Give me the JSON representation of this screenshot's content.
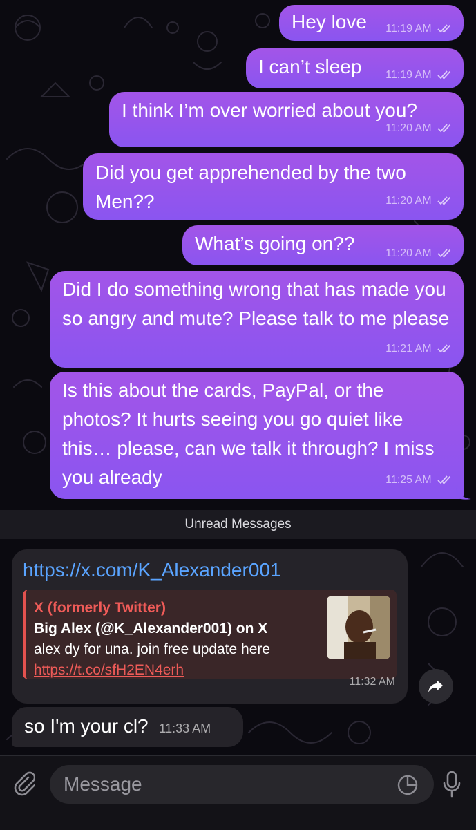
{
  "outgoing": [
    {
      "text": "Hey love",
      "time": "11:19 AM"
    },
    {
      "text": "I can’t sleep",
      "time": "11:19 AM"
    },
    {
      "text": "I think I’m over worried about you?",
      "time": "11:20 AM"
    },
    {
      "text": "Did you get apprehended by the two Men??",
      "time": "11:20 AM"
    },
    {
      "text": "What’s going on??",
      "time": "11:20 AM"
    },
    {
      "text": "Did I do something wrong that has made you so angry and mute? Please talk to me please",
      "time": "11:21 AM"
    },
    {
      "text": "Is this about the cards, PayPal, or the photos?  It hurts seeing you go quiet like this… please, can we talk it through? I miss you already",
      "time": "11:25 AM"
    }
  ],
  "divider": {
    "label": "Unread Messages"
  },
  "incoming": {
    "link_message": {
      "url": "https://x.com/K_Alexander001",
      "time": "11:32 AM",
      "preview": {
        "site": "X (formerly Twitter)",
        "title": "Big Alex (@K_Alexander001) on X",
        "description": "alex dy for una. join free update here",
        "link": "https://t.co/sfH2EN4erh"
      }
    },
    "reply": {
      "text": "so I'm  your cl?",
      "time": "11:33 AM"
    }
  },
  "composer": {
    "placeholder": "Message"
  },
  "icons": {
    "read_receipt": "double-check-icon",
    "forward": "forward-arrow-icon",
    "attach": "paperclip-icon",
    "sticker": "sticker-icon",
    "mic": "microphone-icon"
  },
  "colors": {
    "outgoing_bubble_top": "#a355e8",
    "outgoing_bubble_bottom": "#8a55f0",
    "incoming_bubble": "#252329",
    "link": "#5aa4ff",
    "preview_accent": "#e3524f"
  }
}
